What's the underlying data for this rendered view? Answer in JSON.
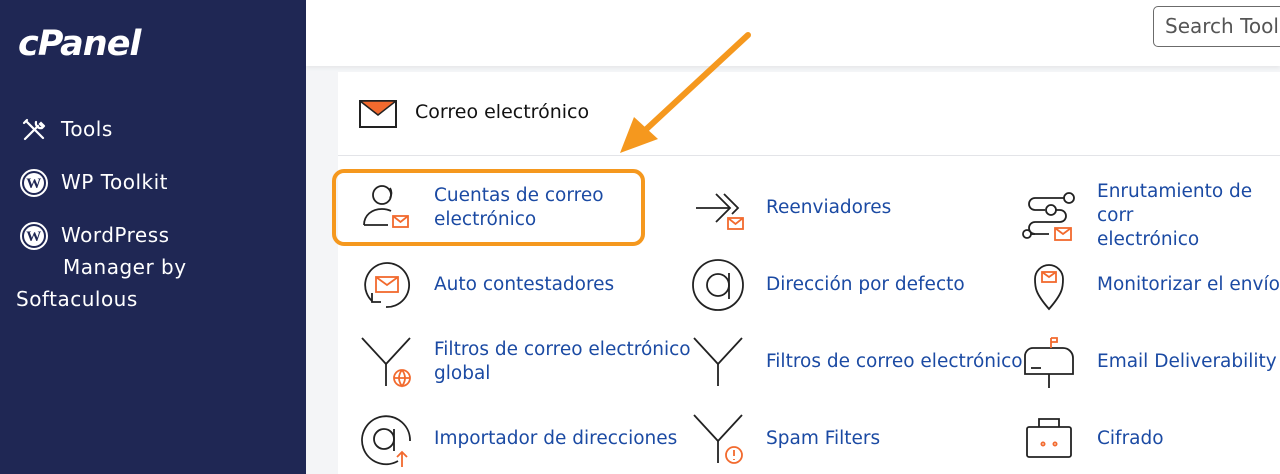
{
  "sidebar": {
    "logo": "cPanel",
    "items": [
      {
        "label": "Tools",
        "icon": "tools-icon"
      },
      {
        "label": "WP Toolkit",
        "icon": "wordpress-icon"
      },
      {
        "label_line1": "WordPress",
        "label_line2": "Manager by",
        "label_line3": "Softaculous",
        "icon": "wordpress-icon"
      }
    ]
  },
  "header": {
    "search_text": "Search Tool"
  },
  "section": {
    "title": "Correo electrónico",
    "icon": "envelope-icon"
  },
  "tools": [
    {
      "label_line1": "Cuentas de correo",
      "label_line2": "electrónico",
      "icon": "email-accounts-icon"
    },
    {
      "label": "Reenviadores",
      "icon": "forwarders-icon"
    },
    {
      "label_line1": "Enrutamiento de corr",
      "label_line2": "electrónico",
      "icon": "email-routing-icon"
    },
    {
      "label": "Auto contestadores",
      "icon": "autoresponders-icon"
    },
    {
      "label": "Dirección por defecto",
      "icon": "at-icon"
    },
    {
      "label": "Monitorizar el envío",
      "icon": "location-pin-icon"
    },
    {
      "label_line1": "Filtros de correo electrónico",
      "label_line2": "global",
      "icon": "global-filter-icon"
    },
    {
      "label": "Filtros de correo electrónico",
      "icon": "filter-icon"
    },
    {
      "label": "Email Deliverability",
      "icon": "mailbox-icon"
    },
    {
      "label": "Importador de direcciones",
      "icon": "address-importer-icon"
    },
    {
      "label": "Spam Filters",
      "icon": "spam-filter-icon"
    },
    {
      "label": "Cifrado",
      "icon": "encryption-icon"
    }
  ],
  "colors": {
    "sidebar_bg": "#1f2754",
    "link": "#1b4aa3",
    "accent_orange": "#f5981e",
    "icon_orange": "#f26a2e"
  }
}
